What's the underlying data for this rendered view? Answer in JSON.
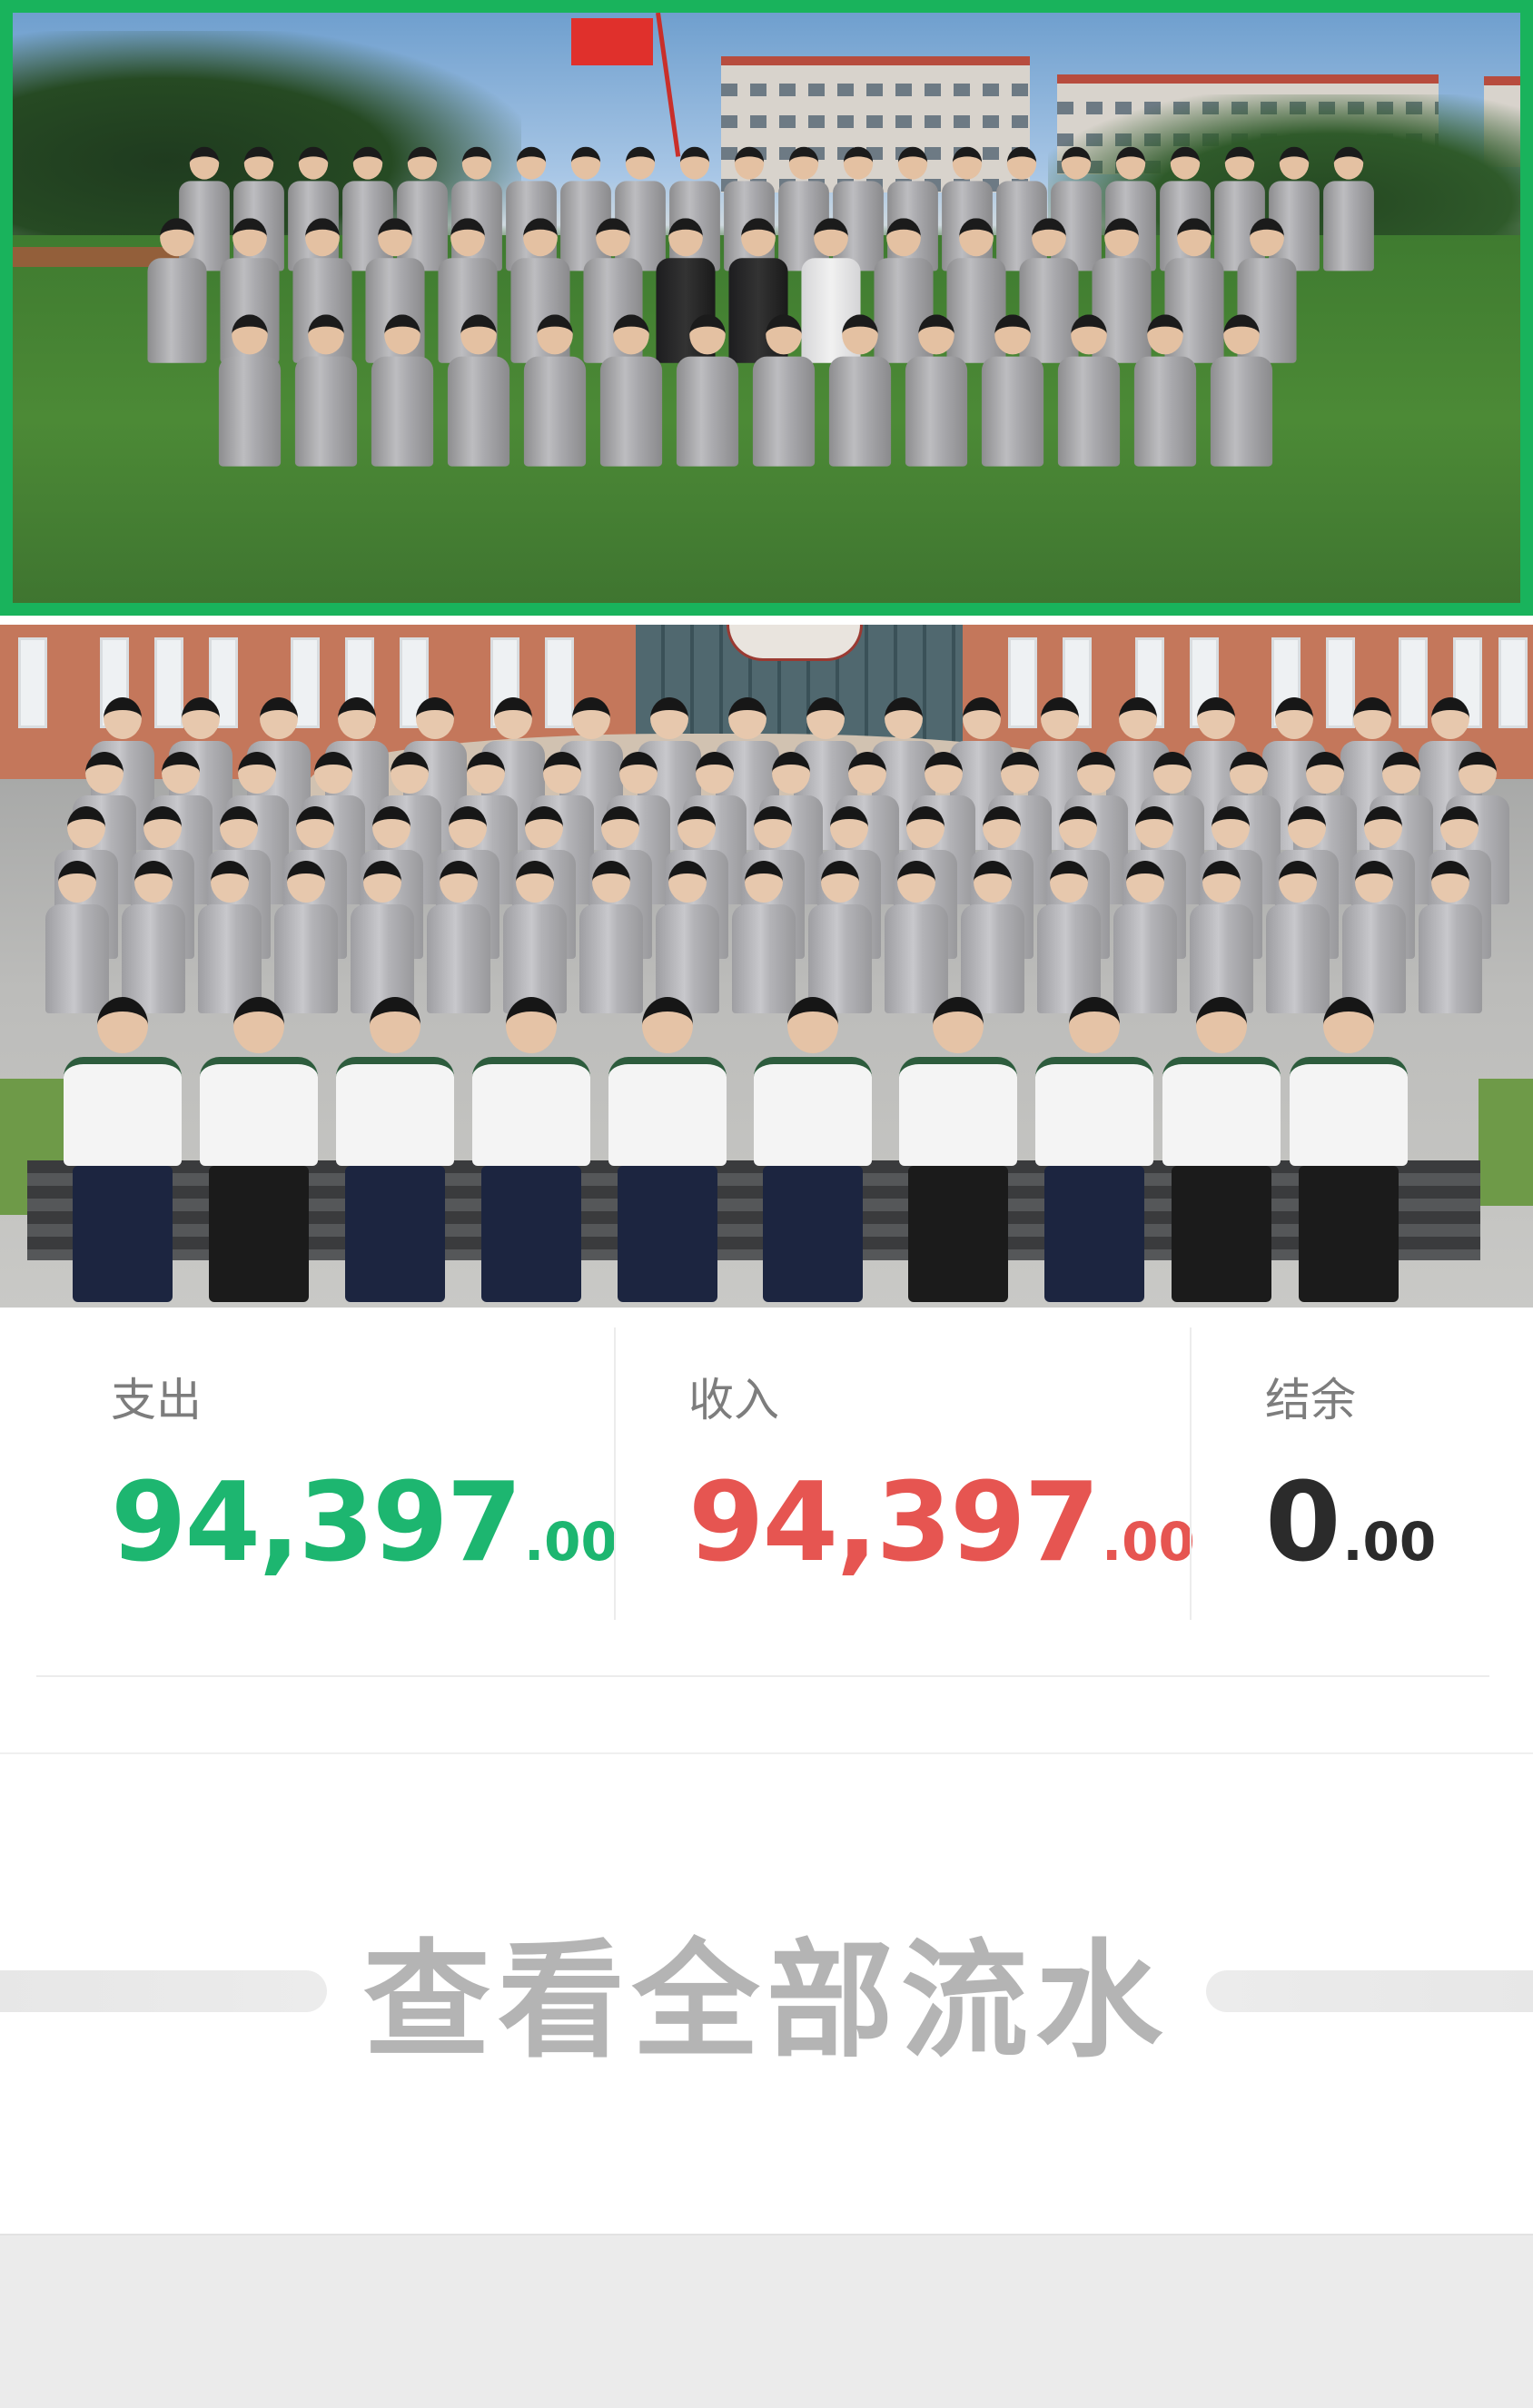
{
  "photos": {
    "top_alt": "class-photo-outdoor",
    "bottom_alt": "class-photo-with-teachers"
  },
  "summary": {
    "expense": {
      "label": "支出",
      "integer": "94,397",
      "decimal": ".00",
      "color": "#1db670"
    },
    "income": {
      "label": "收入",
      "integer": "94,397",
      "decimal": ".00",
      "color": "#e65551"
    },
    "balance": {
      "label": "结余",
      "integer": "0",
      "decimal": ".00",
      "color": "#2b2b2b"
    }
  },
  "view_all": {
    "label": "查看全部流水"
  },
  "colors": {
    "photo_border": "#19b35c"
  }
}
